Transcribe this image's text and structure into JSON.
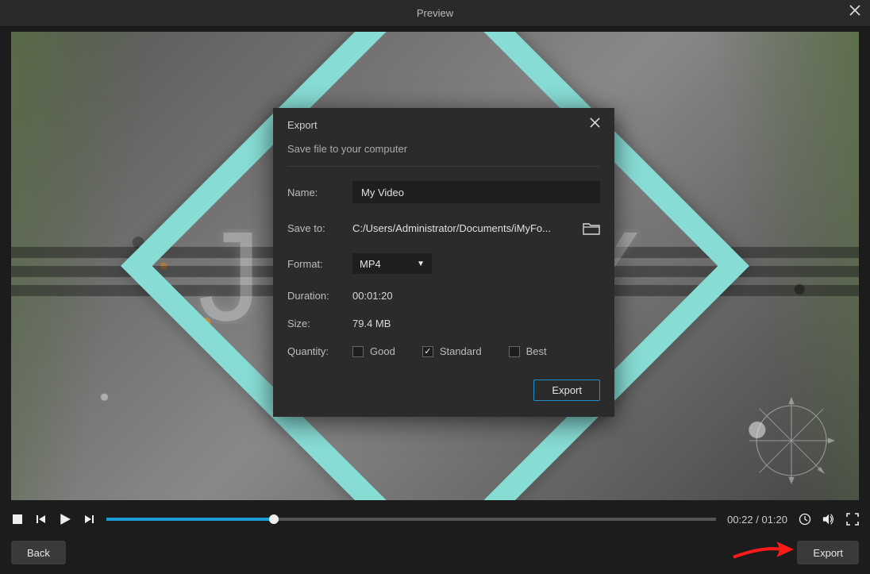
{
  "titlebar": {
    "title": "Preview"
  },
  "player": {
    "current_time": "00:22",
    "total_time": "01:20",
    "time_text": "00:22 / 01:20"
  },
  "footer": {
    "back_label": "Back",
    "export_label": "Export"
  },
  "modal": {
    "title": "Export",
    "subtitle": "Save file to your computer",
    "name_label": "Name:",
    "name_value": "My Video",
    "saveto_label": "Save to:",
    "saveto_value": "C:/Users/Administrator/Documents/iMyFo...",
    "format_label": "Format:",
    "format_value": "MP4",
    "duration_label": "Duration:",
    "duration_value": "00:01:20",
    "size_label": "Size:",
    "size_value": "79.4 MB",
    "quality_label": "Quantity:",
    "quality_options": {
      "good": "Good",
      "standard": "Standard",
      "best": "Best"
    },
    "quality_selected": "standard",
    "export_button": "Export"
  }
}
